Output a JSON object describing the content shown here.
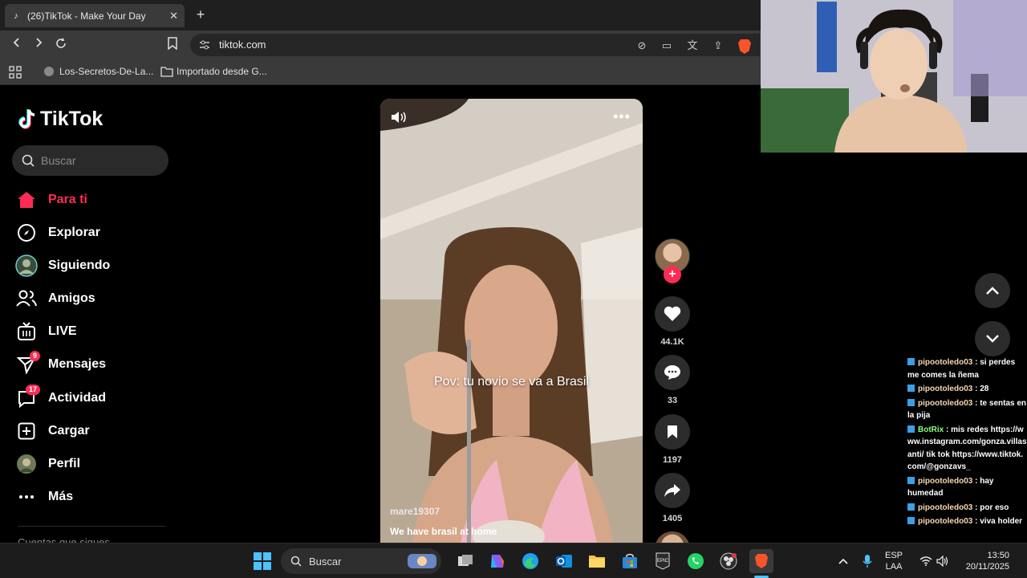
{
  "browser": {
    "tab_title": "(26)TikTok - Make Your Day",
    "url": "tiktok.com",
    "bookmarks": [
      "Los-Secretos-De-La...",
      "Importado desde G..."
    ]
  },
  "tiktok": {
    "logo": "TikTok",
    "search_placeholder": "Buscar",
    "nav": [
      {
        "label": "Para ti",
        "icon": "home-icon"
      },
      {
        "label": "Explorar",
        "icon": "compass-icon"
      },
      {
        "label": "Siguiendo",
        "icon": "following-avatar-icon"
      },
      {
        "label": "Amigos",
        "icon": "friends-icon"
      },
      {
        "label": "LIVE",
        "icon": "live-tv-icon"
      },
      {
        "label": "Mensajes",
        "icon": "send-icon",
        "badge": "9"
      },
      {
        "label": "Actividad",
        "icon": "activity-icon",
        "badge": "17"
      },
      {
        "label": "Cargar",
        "icon": "upload-plus-icon"
      },
      {
        "label": "Perfil",
        "icon": "profile-avatar-icon"
      },
      {
        "label": "Más",
        "icon": "more-dots-icon"
      }
    ],
    "cut_text": "Cuentas que sigues",
    "video": {
      "caption": "Pov: tu novio se va a Brasil",
      "author": "mare19307",
      "description": "We have brasil at home"
    },
    "actions": {
      "likes": "44.1K",
      "comments": "33",
      "saves": "1197",
      "shares": "1405"
    }
  },
  "chat": [
    {
      "user": "pipootoledo03",
      "text": " : si perdes me comes la ñema"
    },
    {
      "user": "pipootoledo03",
      "text": " : 28"
    },
    {
      "user": "pipootoledo03",
      "text": " : te sentas en la pija"
    },
    {
      "user": "BotRix",
      "text": " : mis redes https://www.instagram.com/gonza.villasanti/ tik tok https://www.tiktok.com/@gonzavs_",
      "bot": true
    },
    {
      "user": "pipootoledo03",
      "text": " : hay humedad"
    },
    {
      "user": "pipootoledo03",
      "text": " : por eso"
    },
    {
      "user": "pipootoledo03",
      "text": " : viva holder"
    }
  ],
  "taskbar": {
    "search_label": "Buscar",
    "lang_line1": "ESP",
    "lang_line2": "LAA",
    "time": "13:50",
    "date": "20/11/2025"
  },
  "colors": {
    "accent": "#fe2c55",
    "bg": "#000000"
  }
}
